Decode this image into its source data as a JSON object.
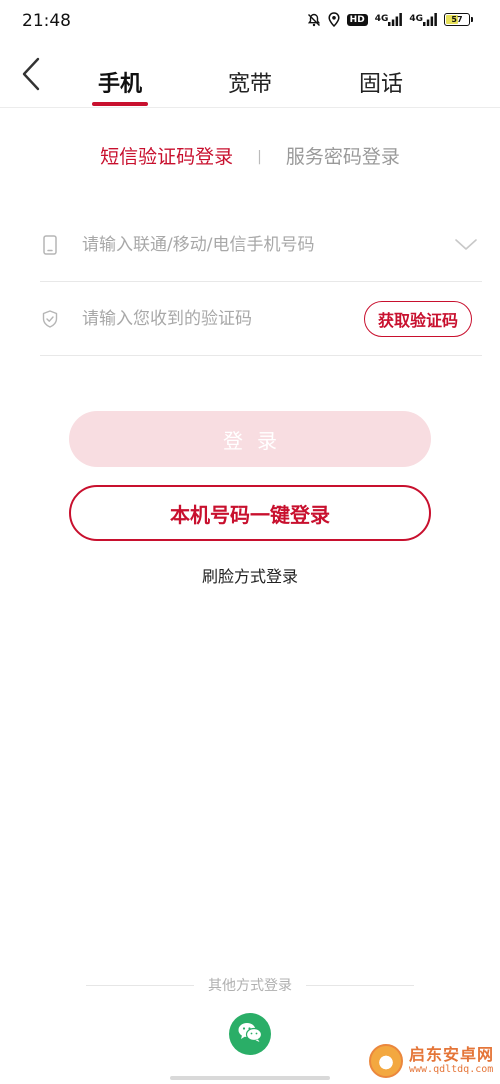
{
  "status_bar": {
    "time": "21:48",
    "icons": [
      "bell-off-icon",
      "location-icon",
      "hd-icon",
      "signal-4g-icon",
      "signal-4g-icon",
      "battery-icon"
    ],
    "hd_label": "HD",
    "network_1": "4G",
    "network_2": "4G",
    "battery_level": "57",
    "battery_fraction": 0.57
  },
  "header": {
    "back_icon": "chevron-left-icon",
    "tabs": [
      {
        "label": "手机",
        "active": true
      },
      {
        "label": "宽带",
        "active": false
      },
      {
        "label": "固话",
        "active": false
      }
    ]
  },
  "login_switch": {
    "sms_label": "短信验证码登录",
    "divider": "|",
    "password_label": "服务密码登录"
  },
  "form": {
    "phone": {
      "placeholder": "请输入联通/移动/电信手机号码",
      "value": "",
      "icon": "phone-icon",
      "dropdown_icon": "chevron-down-icon"
    },
    "code": {
      "placeholder": "请输入您收到的验证码",
      "value": "",
      "icon": "shield-check-icon",
      "get_code_label": "获取验证码"
    }
  },
  "buttons": {
    "login_label": "登录",
    "onekey_label": "本机号码一键登录",
    "face_label": "刷脸方式登录"
  },
  "other_methods": {
    "label": "其他方式登录",
    "wechat_icon": "wechat-icon"
  },
  "watermark": {
    "title": "启东安卓网",
    "url": "www.qdltdq.com"
  },
  "colors": {
    "accent": "#c8102e",
    "login_disabled": "#f8dde1",
    "wechat": "#2aae67"
  }
}
